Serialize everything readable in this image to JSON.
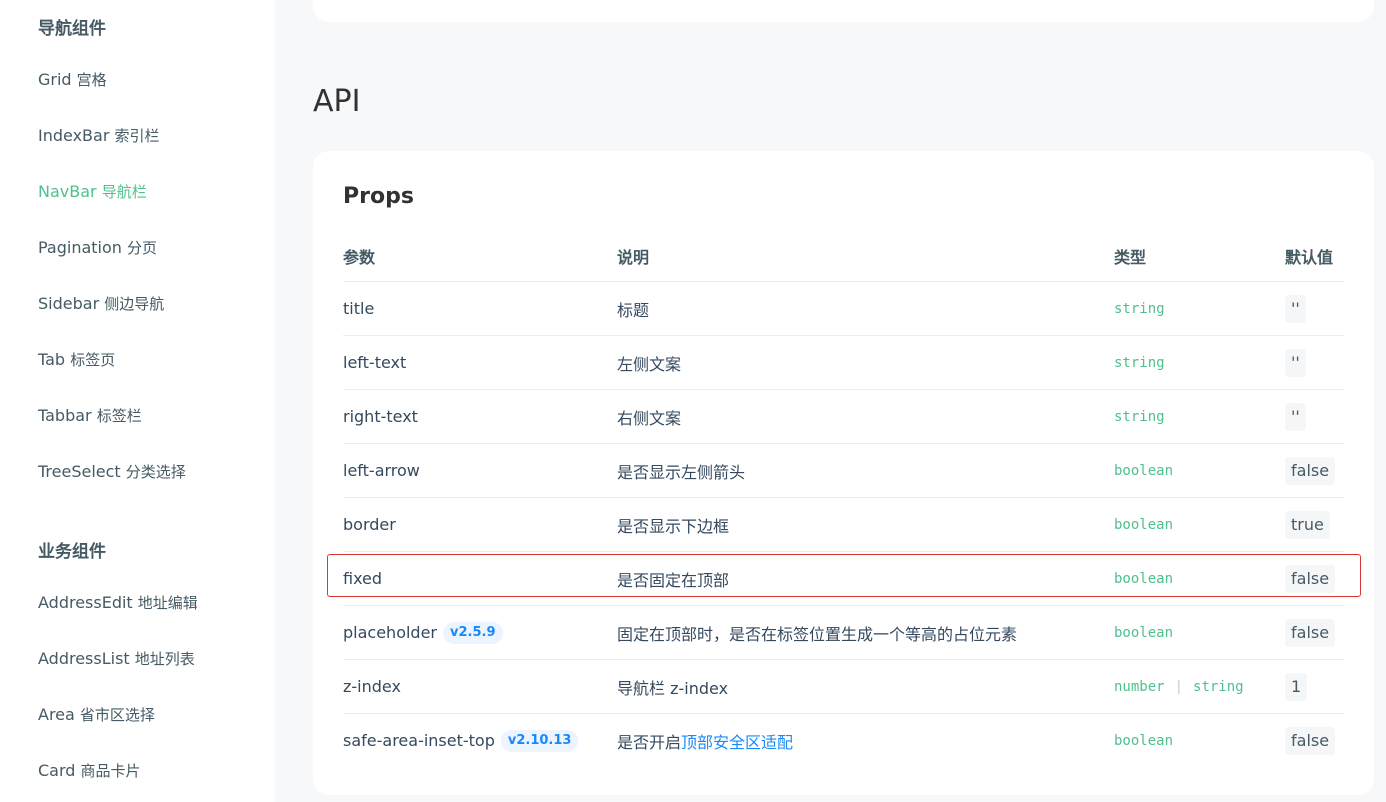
{
  "sidebar": {
    "groups": [
      {
        "title": "导航组件",
        "items": [
          {
            "en": "Grid",
            "zh": "宫格"
          },
          {
            "en": "IndexBar",
            "zh": "索引栏"
          },
          {
            "en": "NavBar",
            "zh": "导航栏"
          },
          {
            "en": "Pagination",
            "zh": "分页"
          },
          {
            "en": "Sidebar",
            "zh": "侧边导航"
          },
          {
            "en": "Tab",
            "zh": "标签页"
          },
          {
            "en": "Tabbar",
            "zh": "标签栏"
          },
          {
            "en": "TreeSelect",
            "zh": "分类选择"
          }
        ]
      },
      {
        "title": "业务组件",
        "items": [
          {
            "en": "AddressEdit",
            "zh": "地址编辑"
          },
          {
            "en": "AddressList",
            "zh": "地址列表"
          },
          {
            "en": "Area",
            "zh": "省市区选择"
          },
          {
            "en": "Card",
            "zh": "商品卡片"
          }
        ]
      }
    ],
    "active_item": "NavBar 导航栏"
  },
  "main": {
    "section_title": "API",
    "props_title": "Props",
    "headers": [
      "参数",
      "说明",
      "类型",
      "默认值"
    ],
    "rows": [
      {
        "param": "title",
        "desc": "标题",
        "type": "string",
        "default": "''"
      },
      {
        "param": "left-text",
        "desc": "左侧文案",
        "type": "string",
        "default": "''"
      },
      {
        "param": "right-text",
        "desc": "右侧文案",
        "type": "string",
        "default": "''"
      },
      {
        "param": "left-arrow",
        "desc": "是否显示左侧箭头",
        "type": "boolean",
        "default": "false"
      },
      {
        "param": "border",
        "desc": "是否显示下边框",
        "type": "boolean",
        "default": "true"
      },
      {
        "param": "fixed",
        "desc": "是否固定在顶部",
        "type": "boolean",
        "default": "false"
      },
      {
        "param": "placeholder",
        "version": "v2.5.9",
        "desc": "固定在顶部时，是否在标签位置生成一个等高的占位元素",
        "type": "boolean",
        "default": "false"
      },
      {
        "param": "z-index",
        "desc": "导航栏 z-index",
        "type_a": "number",
        "type_sep": "|",
        "type_b": "string",
        "default": "1"
      },
      {
        "param": "safe-area-inset-top",
        "version": "v2.10.13",
        "desc_prefix": "是否开启",
        "desc_link": "顶部安全区适配",
        "type": "boolean",
        "default": "false"
      }
    ]
  },
  "colors": {
    "accent": "#4fc08d",
    "link": "#1989fa",
    "highlight_border": "#d93636"
  }
}
